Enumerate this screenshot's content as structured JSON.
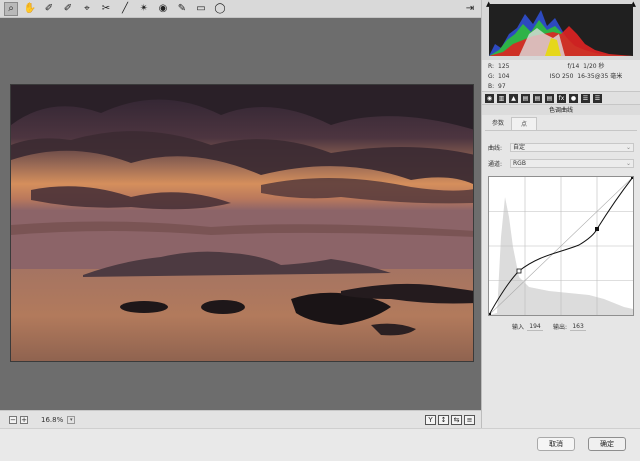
{
  "toolbar": {
    "tools": [
      {
        "name": "zoom-tool",
        "glyph": "⌕"
      },
      {
        "name": "hand-tool",
        "glyph": "✋"
      },
      {
        "name": "white-balance-tool",
        "glyph": "✐"
      },
      {
        "name": "color-sampler-tool",
        "glyph": "✐"
      },
      {
        "name": "targeted-adjust-tool",
        "glyph": "⌖"
      },
      {
        "name": "crop-tool",
        "glyph": "✂"
      },
      {
        "name": "straighten-tool",
        "glyph": "╱"
      },
      {
        "name": "spot-removal-tool",
        "glyph": "✴"
      },
      {
        "name": "red-eye-tool",
        "glyph": "◉"
      },
      {
        "name": "adjustment-brush-tool",
        "glyph": "✎"
      },
      {
        "name": "graduated-filter-tool",
        "glyph": "▭"
      },
      {
        "name": "radial-filter-tool",
        "glyph": "◯"
      }
    ],
    "exit_glyph": "⇥"
  },
  "preview": {
    "zoom_out": "−",
    "zoom_in": "+",
    "zoom_level": "16.8%",
    "zoom_dropdown": "▾",
    "right_icons": [
      "Y",
      "↕",
      "⇆",
      "≡"
    ]
  },
  "readout": {
    "r_label": "R:",
    "r_value": "125",
    "g_label": "G:",
    "g_value": "104",
    "b_label": "B:",
    "b_value": "97",
    "aperture": "f/14",
    "shutter": "1/20 秒",
    "iso": "ISO 250",
    "lens": "16-35@35 毫米"
  },
  "panel": {
    "title": "色调曲线",
    "tabs": [
      "参数",
      "点"
    ],
    "curve_label": "曲线:",
    "curve_value": "自定",
    "channel_label": "通道:",
    "channel_value": "RGB",
    "input_label": "输入",
    "input_value": "194",
    "output_label": "输出:",
    "output_value": "163"
  },
  "footer": {
    "cancel": "取消",
    "ok": "确定"
  },
  "colors": {
    "preview_bg": "#6d6d6d",
    "panel_bg": "#e6e6e6",
    "histogram_bg": "#202020"
  }
}
